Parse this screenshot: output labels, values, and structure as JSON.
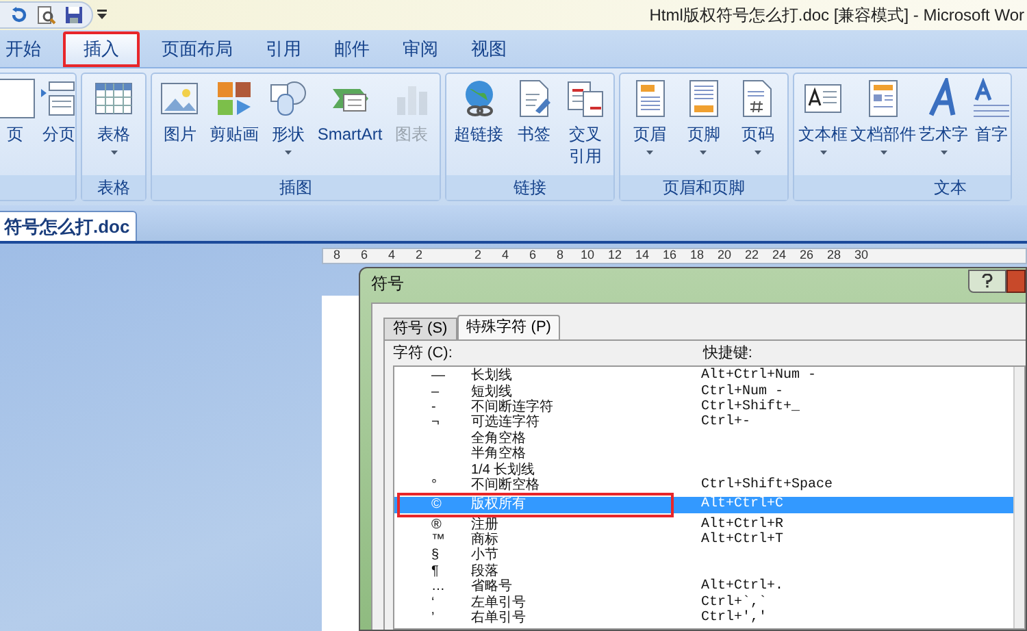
{
  "window": {
    "title": "Html版权符号怎么打.doc [兼容模式] - Microsoft Wor"
  },
  "ribbon_tabs": [
    {
      "label": "开始",
      "selected": false
    },
    {
      "label": "插入",
      "selected": true
    },
    {
      "label": "页面布局",
      "selected": false
    },
    {
      "label": "引用",
      "selected": false
    },
    {
      "label": "邮件",
      "selected": false
    },
    {
      "label": "审阅",
      "selected": false
    },
    {
      "label": "视图",
      "selected": false
    }
  ],
  "ribbon_groups": [
    {
      "buttons": [
        {
          "label": "页",
          "dropdown": false,
          "disabled": false
        },
        {
          "label": "分页",
          "dropdown": false,
          "disabled": false
        }
      ]
    },
    {
      "label": "表格",
      "buttons": [
        {
          "label": "表格",
          "dropdown": true,
          "disabled": false
        }
      ]
    },
    {
      "label": "插图",
      "buttons": [
        {
          "label": "图片",
          "dropdown": false,
          "disabled": false
        },
        {
          "label": "剪贴画",
          "dropdown": false,
          "disabled": false
        },
        {
          "label": "形状",
          "dropdown": true,
          "disabled": false
        },
        {
          "label": "SmartArt",
          "dropdown": false,
          "disabled": false
        },
        {
          "label": "图表",
          "dropdown": false,
          "disabled": true
        }
      ]
    },
    {
      "label": "链接",
      "buttons": [
        {
          "label": "超链接",
          "dropdown": false,
          "disabled": false
        },
        {
          "label": "书签",
          "dropdown": false,
          "disabled": false
        },
        {
          "label": "交叉引用",
          "dropdown": false,
          "disabled": false
        }
      ]
    },
    {
      "label": "页眉和页脚",
      "buttons": [
        {
          "label": "页眉",
          "dropdown": true,
          "disabled": false
        },
        {
          "label": "页脚",
          "dropdown": true,
          "disabled": false
        },
        {
          "label": "页码",
          "dropdown": true,
          "disabled": false
        }
      ]
    },
    {
      "label": "文本",
      "buttons": [
        {
          "label": "文本框",
          "dropdown": true,
          "disabled": false
        },
        {
          "label": "文档部件",
          "dropdown": true,
          "disabled": false
        },
        {
          "label": "艺术字",
          "dropdown": true,
          "disabled": false
        },
        {
          "label": "首字",
          "dropdown": false,
          "disabled": false
        }
      ]
    }
  ],
  "document_tab": {
    "label": "符号怎么打.doc"
  },
  "ruler": {
    "labels": [
      "8",
      "6",
      "4",
      "2",
      "2",
      "4",
      "6",
      "8",
      "10",
      "12",
      "14",
      "16",
      "18",
      "20",
      "22",
      "24",
      "26",
      "28",
      "30"
    ]
  },
  "dialog": {
    "title": "符号",
    "tabs": [
      {
        "label": "符号 (S)",
        "selected": false
      },
      {
        "label": "特殊字符 (P)",
        "selected": true
      }
    ],
    "list_label": "字符 (C):",
    "shortcut_header": "快捷键:",
    "rows": [
      {
        "character": "—",
        "name": "长划线",
        "shortcut": "Alt+Ctrl+Num -",
        "selected": false
      },
      {
        "character": "–",
        "name": "短划线",
        "shortcut": "Ctrl+Num -",
        "selected": false
      },
      {
        "character": "‑",
        "name": "不间断连字符",
        "shortcut": "Ctrl+Shift+_",
        "selected": false
      },
      {
        "character": "¬",
        "name": "可选连字符",
        "shortcut": "Ctrl+-",
        "selected": false
      },
      {
        "name": "全角空格",
        "selected": false
      },
      {
        "name": "半角空格",
        "selected": false
      },
      {
        "name": "1/4 长划线",
        "selected": false
      },
      {
        "character": "°",
        "name": "不间断空格",
        "shortcut": "Ctrl+Shift+Space",
        "selected": false
      },
      {
        "character": "©",
        "name": "版权所有",
        "shortcut": "Alt+Ctrl+C",
        "selected": true
      },
      {
        "character": "®",
        "name": "注册",
        "shortcut": "Alt+Ctrl+R",
        "selected": false
      },
      {
        "character": "™",
        "name": "商标",
        "shortcut": "Alt+Ctrl+T",
        "selected": false
      },
      {
        "character": "§",
        "name": "小节",
        "selected": false
      },
      {
        "character": "¶",
        "name": "段落",
        "selected": false
      },
      {
        "character": "…",
        "name": "省略号",
        "shortcut": "Alt+Ctrl+.",
        "selected": false
      },
      {
        "character": "‘",
        "name": "左单引号",
        "shortcut": "Ctrl+`,`",
        "selected": false
      },
      {
        "character": "’",
        "name": "右单引号",
        "shortcut": "Ctrl+',' ",
        "selected": false
      }
    ]
  }
}
